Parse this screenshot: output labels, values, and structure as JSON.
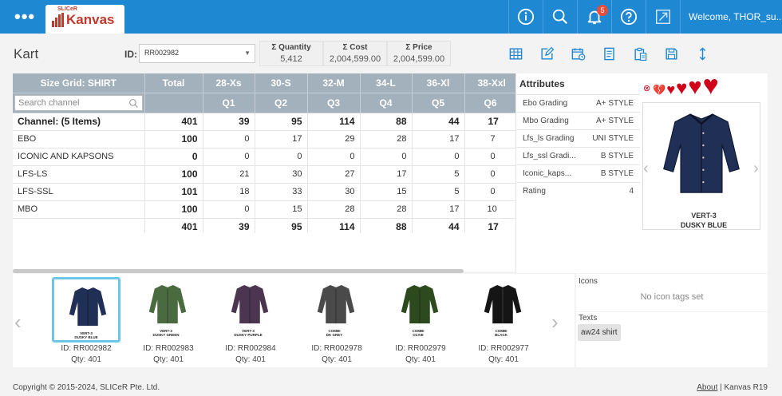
{
  "topbar": {
    "menu_icon": "ellipsis-icon",
    "logo_small": "SLICeR",
    "logo_text": "Kanvas",
    "notification_count": "5",
    "welcome": "Welcome, THOR_su...",
    "icons": [
      "info-icon",
      "search-icon",
      "bell-icon",
      "help-icon",
      "expand-icon"
    ]
  },
  "header": {
    "title": "Kart",
    "id_label": "ID:",
    "id_value": "RR002982",
    "sums": [
      {
        "label": "Σ Quantity",
        "value": "5,412"
      },
      {
        "label": "Σ Cost",
        "value": "2,004,599.00"
      },
      {
        "label": "Σ Price",
        "value": "2,004,599.00"
      }
    ],
    "tools": [
      "table-icon",
      "edit-icon",
      "calendar-icon",
      "document-icon",
      "clipboard-icon",
      "save-icon",
      "sort-vertical-icon"
    ]
  },
  "grid": {
    "size_header": "Size Grid: SHIRT",
    "total_header": "Total",
    "search_placeholder": "Search channel",
    "sizes": [
      "28-Xs",
      "30-S",
      "32-M",
      "34-L",
      "36-Xl",
      "38-Xxl"
    ],
    "quarters": [
      "Q1",
      "Q2",
      "Q3",
      "Q4",
      "Q5",
      "Q6"
    ],
    "channel_row": {
      "label": "Channel: (5 Items)",
      "total": "401",
      "values": [
        "39",
        "95",
        "114",
        "88",
        "44",
        "17"
      ]
    },
    "rows": [
      {
        "label": "EBO",
        "total": "100",
        "values": [
          "0",
          "17",
          "29",
          "28",
          "17",
          "7"
        ]
      },
      {
        "label": "ICONIC AND KAPSONS",
        "total": "0",
        "values": [
          "0",
          "0",
          "0",
          "0",
          "0",
          "0"
        ]
      },
      {
        "label": "LFS-LS",
        "total": "100",
        "values": [
          "21",
          "30",
          "27",
          "17",
          "5",
          "0"
        ]
      },
      {
        "label": "LFS-SSL",
        "total": "101",
        "values": [
          "18",
          "33",
          "30",
          "15",
          "5",
          "0"
        ]
      },
      {
        "label": "MBO",
        "total": "100",
        "values": [
          "0",
          "15",
          "28",
          "28",
          "17",
          "10"
        ]
      }
    ],
    "total_row": {
      "label": "",
      "total": "401",
      "values": [
        "39",
        "95",
        "114",
        "88",
        "44",
        "17"
      ]
    }
  },
  "attributes": {
    "title": "Attributes",
    "items": [
      {
        "key": "Ebo Grading",
        "value": "A+ STYLE"
      },
      {
        "key": "Mbo Grading",
        "value": "A+ STYLE"
      },
      {
        "key": "Lfs_ls Grading",
        "value": "UNI STYLE"
      },
      {
        "key": "Lfs_ssl Gradi...",
        "value": "B STYLE"
      },
      {
        "key": "Iconic_kaps...",
        "value": "B STYLE"
      },
      {
        "key": "Rating",
        "value": "4"
      }
    ]
  },
  "product": {
    "caption_line1": "VERT-3",
    "caption_line2": "DUSKY BLUE",
    "shirt_color": "#1f2f55",
    "heart_color": "#d0021b"
  },
  "strip": {
    "cards": [
      {
        "l1": "VERT-3",
        "l2": "DUSKY BLUE",
        "id": "ID: RR002982",
        "qty": "Qty: 401",
        "color": "#1f2f55"
      },
      {
        "l1": "VERT-3",
        "l2": "DUSKY GREEN",
        "id": "ID: RR002983",
        "qty": "Qty: 401",
        "color": "#4a6a3f"
      },
      {
        "l1": "VERT-3",
        "l2": "DUSKY PURPLE",
        "id": "ID: RR002984",
        "qty": "Qty: 401",
        "color": "#4b3550"
      },
      {
        "l1": "COMBI",
        "l2": "DK GREY",
        "id": "ID: RR002978",
        "qty": "Qty: 401",
        "color": "#4a4a4a"
      },
      {
        "l1": "COMBI",
        "l2": "OLIVE",
        "id": "ID: RR002979",
        "qty": "Qty: 401",
        "color": "#2d4a1f"
      },
      {
        "l1": "COMBI",
        "l2": "BLACK",
        "id": "ID: RR002977",
        "qty": "Qty: 401",
        "color": "#151515"
      }
    ]
  },
  "icons_panel": {
    "title": "Icons",
    "empty": "No icon tags set"
  },
  "texts_panel": {
    "title": "Texts",
    "tag": "aw24 shirt"
  },
  "footer": {
    "copyright": "Copyright © 2015-2024, SLICeR Pte. Ltd.",
    "about": "About",
    "version": "| Kanvas R19"
  }
}
